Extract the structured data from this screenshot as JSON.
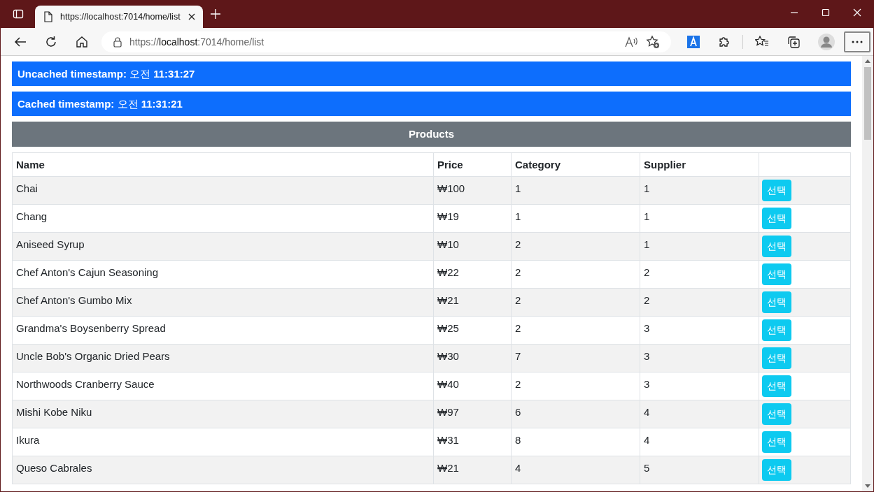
{
  "browser": {
    "tab_title": "https://localhost:7014/home/list",
    "address": {
      "prefix": "https://",
      "host": "localhost",
      "rest": ":7014/home/list"
    }
  },
  "banners": [
    {
      "text": "**Uncached timestamp:** 오전 **11:31:27**"
    },
    {
      "text": "**Cached timestamp:** 오전 **11:31:21**"
    }
  ],
  "title": "Products",
  "table": {
    "columns": [
      "Name",
      "Price",
      "Category",
      "Supplier"
    ],
    "rows": [
      {
        "name": "Chai",
        "price": "₩100",
        "category": "1",
        "supplier": "1",
        "action": "선택"
      },
      {
        "name": "Chang",
        "price": "₩19",
        "category": "1",
        "supplier": "1",
        "action": "선택"
      },
      {
        "name": "Aniseed Syrup",
        "price": "₩10",
        "category": "2",
        "supplier": "1",
        "action": "선택"
      },
      {
        "name": "Chef Anton's Cajun Seasoning",
        "price": "₩22",
        "category": "2",
        "supplier": "2",
        "action": "선택"
      },
      {
        "name": "Chef Anton's Gumbo Mix",
        "price": "₩21",
        "category": "2",
        "supplier": "2",
        "action": "선택"
      },
      {
        "name": "Grandma's Boysenberry Spread",
        "price": "₩25",
        "category": "2",
        "supplier": "3",
        "action": "선택"
      },
      {
        "name": "Uncle Bob's Organic Dried Pears",
        "price": "₩30",
        "category": "7",
        "supplier": "3",
        "action": "선택"
      },
      {
        "name": "Northwoods Cranberry Sauce",
        "price": "₩40",
        "category": "2",
        "supplier": "3",
        "action": "선택"
      },
      {
        "name": "Mishi Kobe Niku",
        "price": "₩97",
        "category": "6",
        "supplier": "4",
        "action": "선택"
      },
      {
        "name": "Ikura",
        "price": "₩31",
        "category": "8",
        "supplier": "4",
        "action": "선택"
      },
      {
        "name": "Queso Cabrales",
        "price": "₩21",
        "category": "4",
        "supplier": "5",
        "action": "선택"
      }
    ]
  }
}
